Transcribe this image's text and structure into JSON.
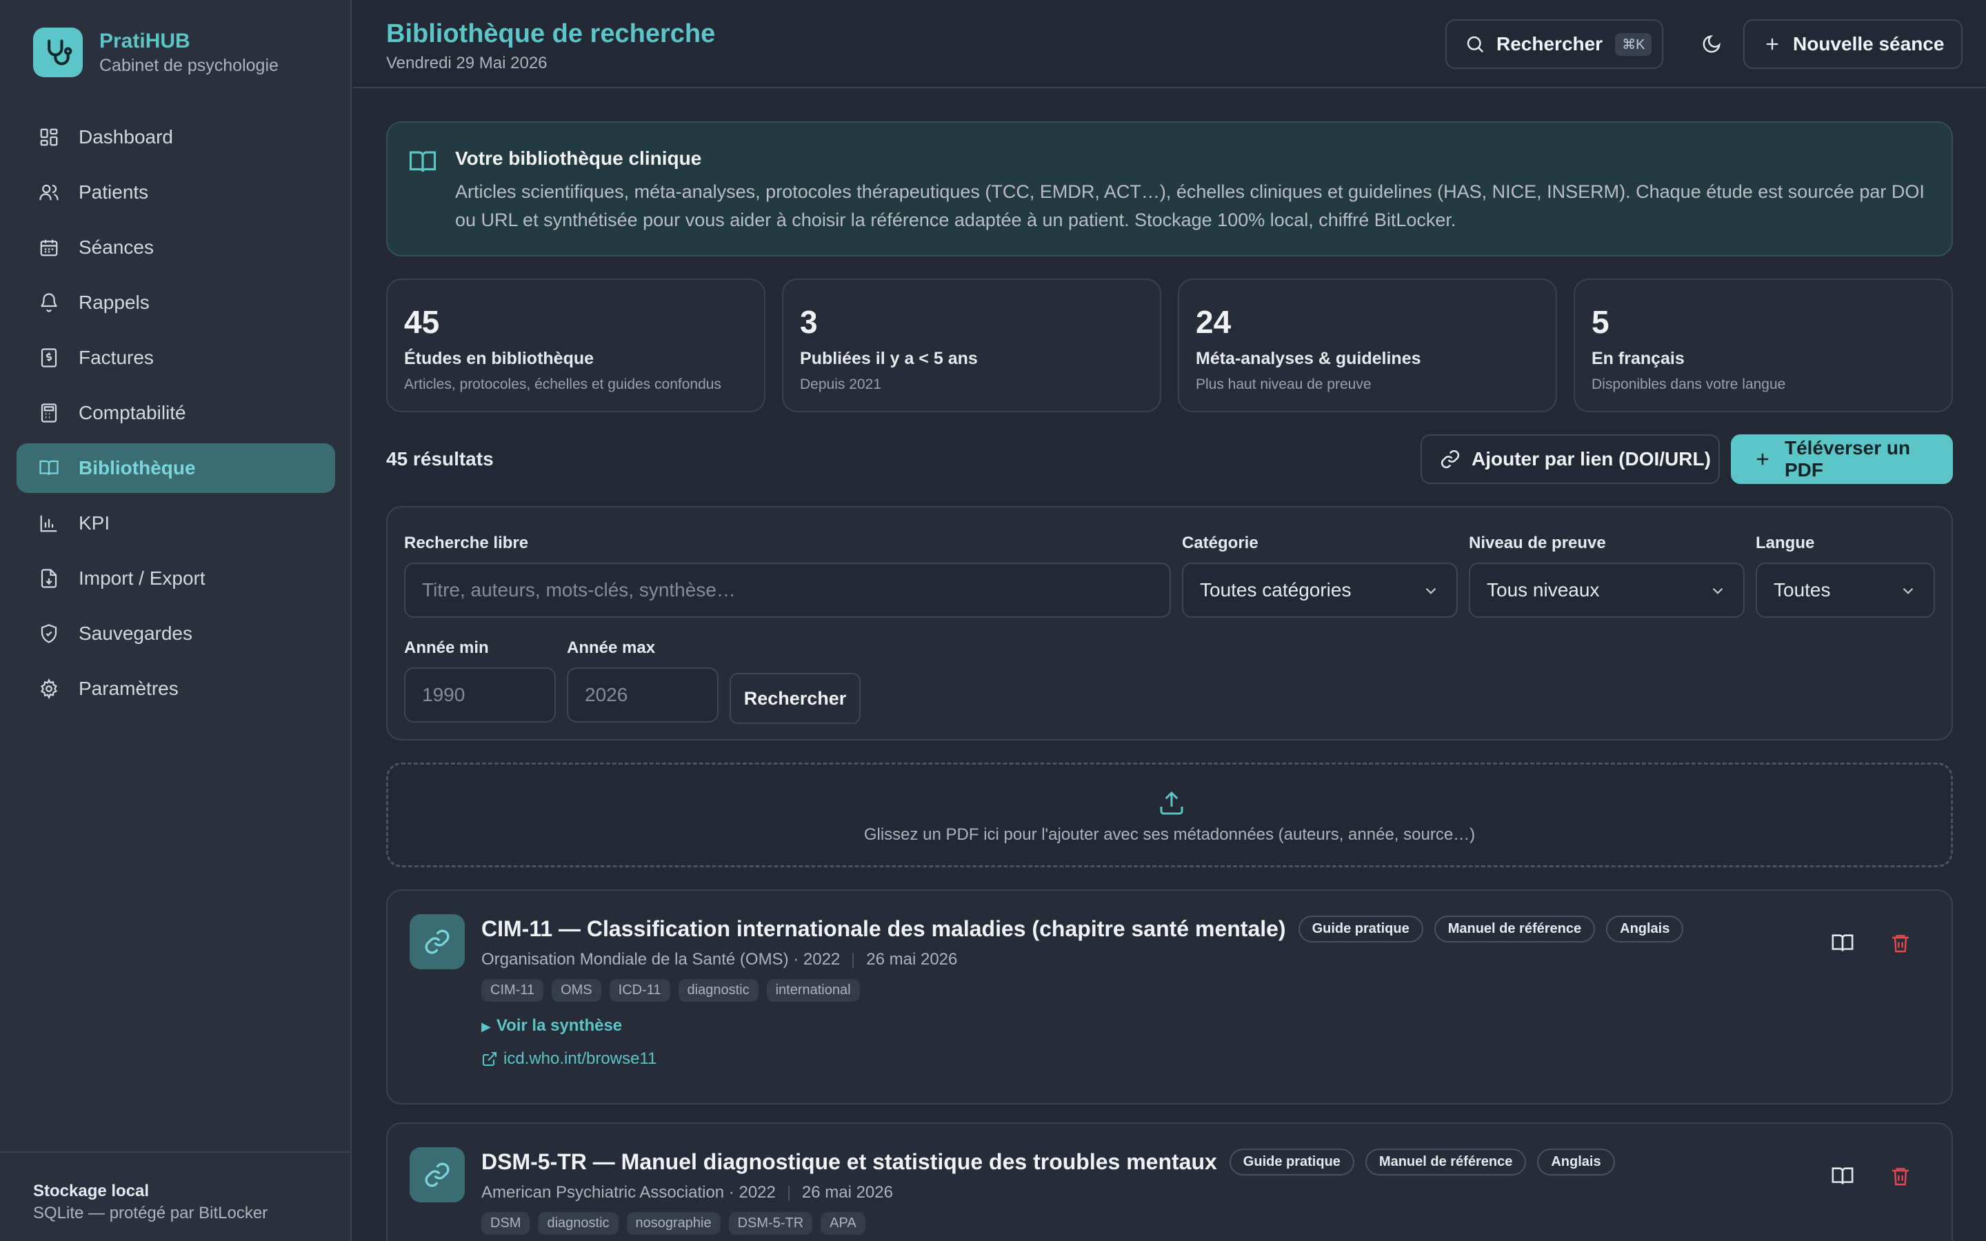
{
  "brand": {
    "name": "PratiHUB",
    "subtitle": "Cabinet de psychologie"
  },
  "nav": [
    {
      "label": "Dashboard",
      "icon": "dashboard-icon"
    },
    {
      "label": "Patients",
      "icon": "users-icon"
    },
    {
      "label": "Séances",
      "icon": "calendar-icon"
    },
    {
      "label": "Rappels",
      "icon": "bell-icon"
    },
    {
      "label": "Factures",
      "icon": "invoice-icon"
    },
    {
      "label": "Comptabilité",
      "icon": "calculator-icon"
    },
    {
      "label": "Bibliothèque",
      "icon": "book-icon",
      "active": true
    },
    {
      "label": "KPI",
      "icon": "chart-icon"
    },
    {
      "label": "Import / Export",
      "icon": "file-import-icon"
    },
    {
      "label": "Sauvegardes",
      "icon": "shield-icon"
    },
    {
      "label": "Paramètres",
      "icon": "gear-icon"
    }
  ],
  "storage": {
    "title": "Stockage local",
    "subtitle": "SQLite — protégé par BitLocker"
  },
  "header": {
    "title": "Bibliothèque de recherche",
    "date": "Vendredi 29 Mai 2026",
    "search_label": "Rechercher",
    "search_shortcut": "⌘K",
    "new_session_label": "Nouvelle séance"
  },
  "info": {
    "title": "Votre bibliothèque clinique",
    "text": "Articles scientifiques, méta-analyses, protocoles thérapeutiques (TCC, EMDR, ACT…), échelles cliniques et guidelines (HAS, NICE, INSERM). Chaque étude est sourcée par DOI ou URL et synthétisée pour vous aider à choisir la référence adaptée à un patient. Stockage 100% local, chiffré BitLocker."
  },
  "stats": [
    {
      "value": "45",
      "label": "Études en bibliothèque",
      "sub": "Articles, protocoles, échelles et guides confondus"
    },
    {
      "value": "3",
      "label": "Publiées il y a < 5 ans",
      "sub": "Depuis 2021"
    },
    {
      "value": "24",
      "label": "Méta-analyses & guidelines",
      "sub": "Plus haut niveau de preuve"
    },
    {
      "value": "5",
      "label": "En français",
      "sub": "Disponibles dans votre langue"
    }
  ],
  "results_label": "45 résultats",
  "actions": {
    "add_link": "Ajouter par lien (DOI/URL)",
    "upload_pdf": "Téléverser un PDF"
  },
  "filters": {
    "free_label": "Recherche libre",
    "free_placeholder": "Titre, auteurs, mots-clés, synthèse…",
    "category_label": "Catégorie",
    "category_value": "Toutes catégories",
    "level_label": "Niveau de preuve",
    "level_value": "Tous niveaux",
    "lang_label": "Langue",
    "lang_value": "Toutes",
    "year_min_label": "Année min",
    "year_min_placeholder": "1990",
    "year_max_label": "Année max",
    "year_max_placeholder": "2026",
    "search_button": "Rechercher"
  },
  "dropzone": {
    "text": "Glissez un PDF ici pour l'ajouter avec ses métadonnées (auteurs, année, source…)"
  },
  "cards": [
    {
      "title": "CIM-11 — Classification internationale des maladies (chapitre santé mentale)",
      "badges": [
        "Guide pratique",
        "Manuel de référence",
        "Anglais"
      ],
      "source": "Organisation Mondiale de la Santé (OMS) · 2022",
      "added": "26 mai 2026",
      "tags": [
        "CIM-11",
        "OMS",
        "ICD-11",
        "diagnostic",
        "international"
      ],
      "synth_label": "Voir la synthèse",
      "url": "icd.who.int/browse11"
    },
    {
      "title": "DSM-5-TR — Manuel diagnostique et statistique des troubles mentaux",
      "badges": [
        "Guide pratique",
        "Manuel de référence",
        "Anglais"
      ],
      "source": "American Psychiatric Association · 2022",
      "added": "26 mai 2026",
      "tags": [
        "DSM",
        "diagnostic",
        "nosographie",
        "DSM-5-TR",
        "APA"
      ]
    }
  ],
  "colors": {
    "accent": "#5cc5c8",
    "danger": "#e5484d",
    "background": "#222834",
    "sidebar": "#2a303c"
  }
}
